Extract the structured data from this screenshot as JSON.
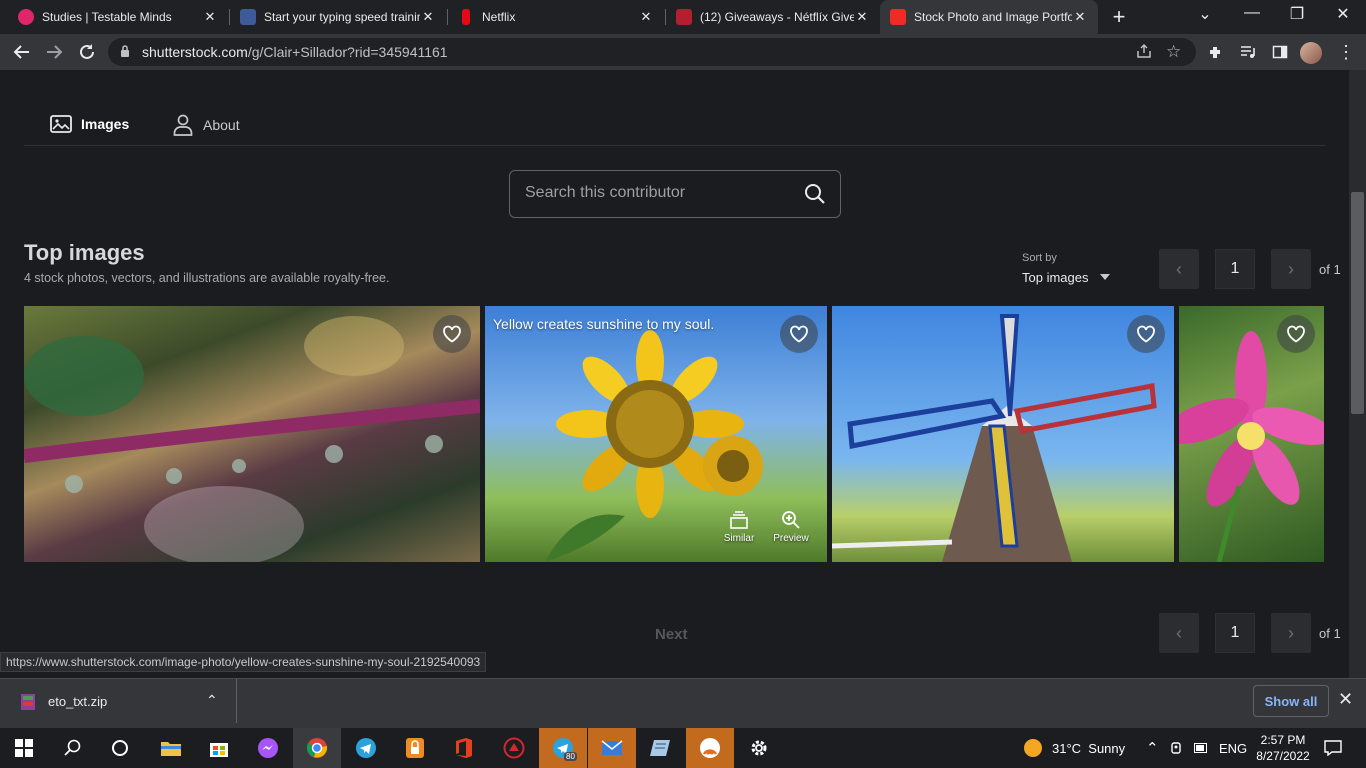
{
  "browser": {
    "tabs": [
      {
        "title": "Studies | Testable Minds",
        "favicon_color": "#e0266b",
        "active": false
      },
      {
        "title": "Start your typing speed training",
        "favicon_color": "#3d5a99",
        "active": false
      },
      {
        "title": "Netflix",
        "favicon_color": "#e50914",
        "active": false
      },
      {
        "title": "(12) Giveaways - Nétflíx Give",
        "favicon_color": "#b2202f",
        "active": false
      },
      {
        "title": "Stock Photo and Image Portfo",
        "favicon_color": "#ee2b24",
        "active": true
      }
    ],
    "close_glyph": "✕",
    "url_domain": "shutterstock.com",
    "url_path": "/g/Clair+Sillador?rid=345941161"
  },
  "page": {
    "nav": {
      "images": "Images",
      "about": "About"
    },
    "search_placeholder": "Search this contributor",
    "heading": "Top images",
    "subheading": "4 stock photos, vectors, and illustrations are available royalty-free.",
    "sort_label": "Sort by",
    "sort_value": "Top images",
    "pagination": {
      "page": "1",
      "of_label": "of 1"
    },
    "images": [
      {
        "alt": "water drops on purple stem",
        "caption": ""
      },
      {
        "alt": "sunflower",
        "caption": "Yellow creates sunshine to my soul.",
        "actions": [
          "Similar",
          "Preview"
        ]
      },
      {
        "alt": "windmill",
        "caption": ""
      },
      {
        "alt": "pink flower",
        "caption": ""
      }
    ],
    "next_label": "Next",
    "status_url": "https://www.shutterstock.com/image-photo/yellow-creates-sunshine-my-soul-2192540093"
  },
  "download_shelf": {
    "file_name": "eto_txt.zip",
    "show_all": "Show all"
  },
  "taskbar": {
    "weather": "31°C  Sunny",
    "language": "ENG",
    "time": "2:57 PM",
    "date": "8/27/2022",
    "telegram_badge": "80"
  }
}
